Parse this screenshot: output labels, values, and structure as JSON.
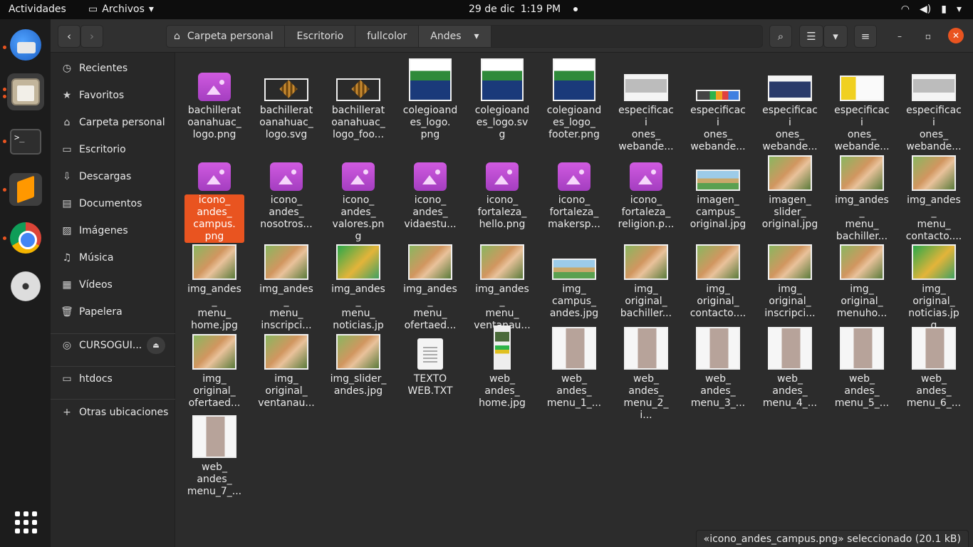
{
  "topbar": {
    "activities": "Actividades",
    "app_menu": "Archivos",
    "date": "29 de dic",
    "time": "1:19 PM"
  },
  "path": {
    "home": "Carpeta personal",
    "crumbs": [
      "Escritorio",
      "fullcolor",
      "Andes"
    ]
  },
  "sidebar": {
    "items": [
      {
        "label": "Recientes",
        "icon": "clock-icon"
      },
      {
        "label": "Favoritos",
        "icon": "star-icon"
      },
      {
        "label": "Carpeta personal",
        "icon": "home-icon"
      },
      {
        "label": "Escritorio",
        "icon": "desktop-icon"
      },
      {
        "label": "Descargas",
        "icon": "download-icon"
      },
      {
        "label": "Documentos",
        "icon": "document-icon"
      },
      {
        "label": "Imágenes",
        "icon": "image-icon"
      },
      {
        "label": "Música",
        "icon": "music-icon"
      },
      {
        "label": "Vídeos",
        "icon": "video-icon"
      },
      {
        "label": "Papelera",
        "icon": "trash-icon"
      }
    ],
    "device": "CURSOGUI...",
    "htdocs": "htdocs",
    "other": "Otras ubicaciones"
  },
  "files": [
    {
      "name": "bachillerat\noanahuac_\nlogo.png",
      "thumb": "purple"
    },
    {
      "name": "bachillerat\noanahuac_\nlogo.svg",
      "thumb": "bach"
    },
    {
      "name": "bachillerat\noanahuac_\nlogo_foo...",
      "thumb": "bach"
    },
    {
      "name": "colegioand\nes_logo.\npng",
      "thumb": "logo"
    },
    {
      "name": "colegioand\nes_logo.svg",
      "thumb": "logo"
    },
    {
      "name": "colegioand\nes_logo_\nfooter.png",
      "thumb": "logo"
    },
    {
      "name": "especificaci\nones_\nwebande...",
      "thumb": "web"
    },
    {
      "name": "especificaci\nones_\nwebande...",
      "thumb": "webstrip"
    },
    {
      "name": "especificaci\nones_\nwebande...",
      "thumb": "webdark"
    },
    {
      "name": "especificaci\nones_\nwebande...",
      "thumb": "webyel"
    },
    {
      "name": "especificaci\nones_\nwebande...",
      "thumb": "web"
    },
    {
      "name": "icono_\nandes_\ncampus.\npng",
      "thumb": "purple",
      "selected": true
    },
    {
      "name": "icono_\nandes_\nnosotros...",
      "thumb": "purple"
    },
    {
      "name": "icono_\nandes_\nvalores.png",
      "thumb": "purple"
    },
    {
      "name": "icono_\nandes_\nvidaestu...",
      "thumb": "purple"
    },
    {
      "name": "icono_\nfortaleza_\nhello.png",
      "thumb": "purple"
    },
    {
      "name": "icono_\nfortaleza_\nmakersp...",
      "thumb": "purple"
    },
    {
      "name": "icono_\nfortaleza_\nreligion.p...",
      "thumb": "purple"
    },
    {
      "name": "imagen_\ncampus_\noriginal.jpg",
      "thumb": "campus"
    },
    {
      "name": "imagen_\nslider_\noriginal.jpg",
      "thumb": "photo"
    },
    {
      "name": "img_andes_\nmenu_\nbachiller...",
      "thumb": "photo"
    },
    {
      "name": "img_andes_\nmenu_\ncontacto....",
      "thumb": "photo"
    },
    {
      "name": "img_andes_\nmenu_\nhome.jpg",
      "thumb": "photo"
    },
    {
      "name": "img_andes_\nmenu_\ninscripci...",
      "thumb": "photo"
    },
    {
      "name": "img_andes_\nmenu_\nnoticias.jpg",
      "thumb": "green"
    },
    {
      "name": "img_andes_\nmenu_\nofertaed...",
      "thumb": "photo"
    },
    {
      "name": "img_andes_\nmenu_\nventanau...",
      "thumb": "photo"
    },
    {
      "name": "img_\ncampus_\nandes.jpg",
      "thumb": "campus"
    },
    {
      "name": "img_\noriginal_\nbachiller...",
      "thumb": "photo"
    },
    {
      "name": "img_\noriginal_\ncontacto....",
      "thumb": "photo"
    },
    {
      "name": "img_\noriginal_\ninscripci...",
      "thumb": "photo"
    },
    {
      "name": "img_\noriginal_\nmenuho...",
      "thumb": "photo"
    },
    {
      "name": "img_\noriginal_\nnoticias.jpg",
      "thumb": "green"
    },
    {
      "name": "img_\noriginal_\nofertaed...",
      "thumb": "photo"
    },
    {
      "name": "img_\noriginal_\nventanau...",
      "thumb": "photo"
    },
    {
      "name": "img_slider_\nandes.jpg",
      "thumb": "photo"
    },
    {
      "name": "TEXTO\nWEB.TXT",
      "thumb": "doc"
    },
    {
      "name": "web_\nandes_\nhome.jpg",
      "thumb": "tall"
    },
    {
      "name": "web_\nandes_\nmenu_1_...",
      "thumb": "webmenu"
    },
    {
      "name": "web_\nandes_\nmenu_2_i...",
      "thumb": "webmenu"
    },
    {
      "name": "web_\nandes_\nmenu_3_...",
      "thumb": "webmenu"
    },
    {
      "name": "web_\nandes_\nmenu_4_...",
      "thumb": "webmenu"
    },
    {
      "name": "web_\nandes_\nmenu_5_...",
      "thumb": "webmenu"
    },
    {
      "name": "web_\nandes_\nmenu_6_...",
      "thumb": "webmenu"
    },
    {
      "name": "web_\nandes_\nmenu_7_...",
      "thumb": "webmenu"
    }
  ],
  "status": "«icono_andes_campus.png» seleccionado  (20.1 kB)",
  "colors": {
    "accent": "#e95420",
    "topbar": "#0d0d0d",
    "dock": "#1c1c1c",
    "window": "#2c2c2c"
  }
}
